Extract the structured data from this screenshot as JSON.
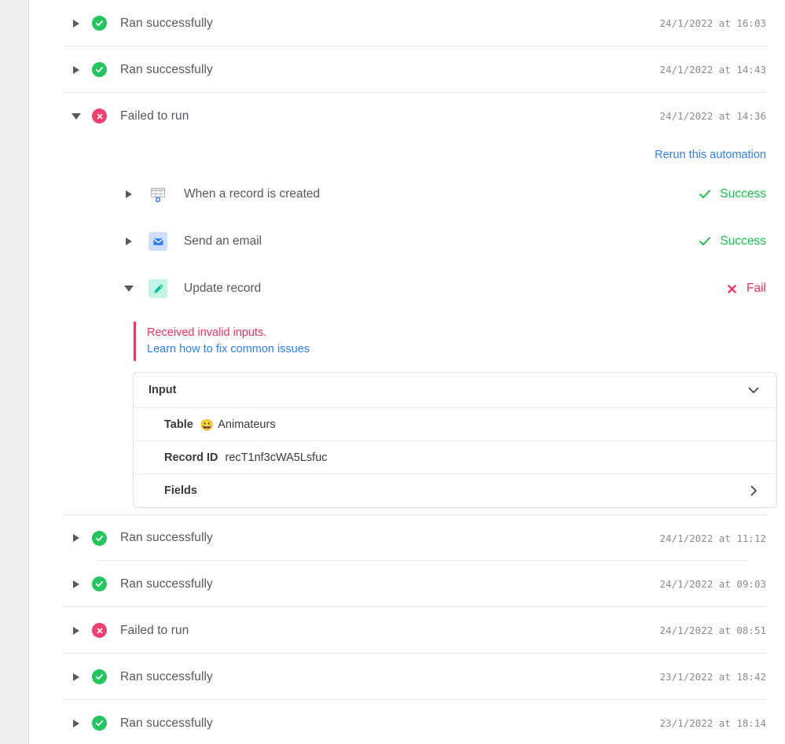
{
  "colors": {
    "success_green": "#22c55e",
    "fail_pink": "#f43f6e",
    "link_blue": "#2d7ff9",
    "error_red": "#f8305a",
    "status_success_text": "#18c14a",
    "rail_gray": "#eeeeee"
  },
  "runs": [
    {
      "id": "run-1",
      "status": "success",
      "status_icon": "check-circle-icon",
      "label": "Ran successfully",
      "timestamp": "24/1/2022 at 16:03",
      "expanded": false,
      "disclosure_icon": "triangle-right-icon"
    },
    {
      "id": "run-2",
      "status": "success",
      "status_icon": "check-circle-icon",
      "label": "Ran successfully",
      "timestamp": "24/1/2022 at 14:43",
      "expanded": false,
      "disclosure_icon": "triangle-right-icon"
    },
    {
      "id": "run-3",
      "status": "failure",
      "status_icon": "x-circle-icon",
      "label": "Failed to run",
      "timestamp": "24/1/2022 at 14:36",
      "expanded": true,
      "disclosure_icon": "triangle-down-icon"
    },
    {
      "id": "run-4",
      "status": "success",
      "status_icon": "check-circle-icon",
      "label": "Ran successfully",
      "timestamp": "24/1/2022 at 11:12",
      "expanded": false,
      "disclosure_icon": "triangle-right-icon"
    },
    {
      "id": "run-5",
      "status": "success",
      "status_icon": "check-circle-icon",
      "label": "Ran successfully",
      "timestamp": "24/1/2022 at 09:03",
      "expanded": false,
      "disclosure_icon": "triangle-right-icon"
    },
    {
      "id": "run-6",
      "status": "failure",
      "status_icon": "x-circle-icon",
      "label": "Failed to run",
      "timestamp": "24/1/2022 at 08:51",
      "expanded": false,
      "disclosure_icon": "triangle-right-icon"
    },
    {
      "id": "run-7",
      "status": "success",
      "status_icon": "check-circle-icon",
      "label": "Ran successfully",
      "timestamp": "23/1/2022 at 18:42",
      "expanded": false,
      "disclosure_icon": "triangle-right-icon"
    },
    {
      "id": "run-8",
      "status": "success",
      "status_icon": "check-circle-icon",
      "label": "Ran successfully",
      "timestamp": "23/1/2022 at 18:14",
      "expanded": false,
      "disclosure_icon": "triangle-right-icon"
    }
  ],
  "expanded_run": {
    "rerun_label": "Rerun this automation",
    "steps": [
      {
        "icon": "table-grid-icon",
        "label": "When a record is created",
        "status_label": "Success",
        "status": "success",
        "expanded": false
      },
      {
        "icon": "envelope-icon",
        "label": "Send an email",
        "status_label": "Success",
        "status": "success",
        "expanded": false
      },
      {
        "icon": "pencil-icon",
        "label": "Update record",
        "status_label": "Fail",
        "status": "failure",
        "expanded": true
      }
    ],
    "error": {
      "message": "Received invalid inputs.",
      "link_label": "Learn how to fix common issues"
    },
    "input_card": {
      "title": "Input",
      "collapse_icon": "chevron-down-icon",
      "rows": [
        {
          "key": "Table",
          "emoji": "😀",
          "value": "Animateurs",
          "has_chevron": false
        },
        {
          "key": "Record ID",
          "emoji": "",
          "value": "recT1nf3cWA5Lsfuc",
          "has_chevron": false
        },
        {
          "key": "Fields",
          "emoji": "",
          "value": "",
          "has_chevron": true,
          "chevron_icon": "chevron-right-icon"
        }
      ]
    }
  }
}
